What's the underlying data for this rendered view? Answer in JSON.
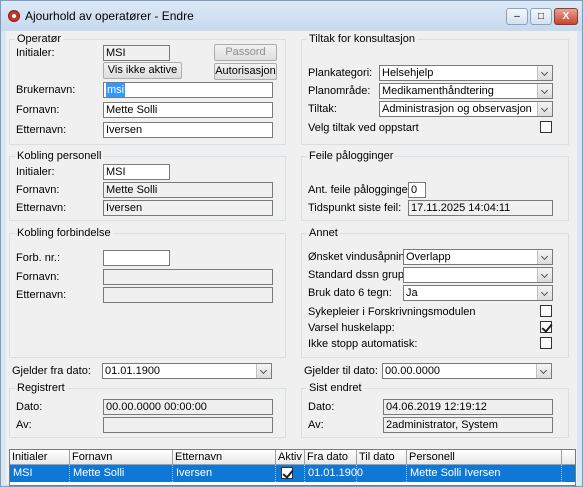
{
  "window": {
    "title": "Ajourhold av operatører - Endre",
    "minimize": "–",
    "maximize": "□",
    "close": "X"
  },
  "operator": {
    "title": "Operatør",
    "initials_label": "Initialer:",
    "initials": "MSI",
    "password_button": "Passord",
    "show_inactive_button": "Vis ikke aktive",
    "authorization_button": "Autorisasjon",
    "username_label": "Brukernavn:",
    "username": "msi",
    "firstname_label": "Fornavn:",
    "firstname": "Mette Solli",
    "lastname_label": "Etternavn:",
    "lastname": "Iversen"
  },
  "measures": {
    "title": "Tiltak for konsultasjon",
    "plan_category_label": "Plankategori:",
    "plan_category": "Helsehjelp",
    "plan_area_label": "Planområde:",
    "plan_area": "Medikamenthåndtering",
    "measure_label": "Tiltak:",
    "measure": "Administrasjon og observasjon",
    "startup_label": "Velg tiltak ved oppstart",
    "startup_checked": false
  },
  "person_link": {
    "title": "Kobling personell",
    "initials_label": "Initialer:",
    "initials": "MSI",
    "firstname_label": "Fornavn:",
    "firstname": "Mette Solli",
    "lastname_label": "Etternavn:",
    "lastname": "Iversen"
  },
  "failed_logins": {
    "title": "Feile pålogginger",
    "count_label": "Ant. feile pålogginger:",
    "count": "0",
    "last_time_label": "Tidspunkt siste feil:",
    "last_time": "17.11.2025 14:04:11"
  },
  "connection_link": {
    "title": "Kobling forbindelse",
    "forb_label": "Forb. nr.:",
    "forb": "",
    "firstname_label": "Fornavn:",
    "firstname": "",
    "lastname_label": "Etternavn:",
    "lastname": ""
  },
  "other": {
    "title": "Annet",
    "window_opening_label": "Ønsket vindusåpning:",
    "window_opening": "Overlapp",
    "standard_group_label": "Standard dssn gruppe:",
    "standard_group": "",
    "date6_label": "Bruk dato 6 tegn:",
    "date6": "Ja",
    "nurse_label": "Sykepleier i Forskrivningsmodulen",
    "nurse_checked": false,
    "reminder_label": "Varsel huskelapp:",
    "reminder_checked": true,
    "autostop_label": "Ikke stopp automatisk:",
    "autostop_checked": false
  },
  "validity": {
    "from_label": "Gjelder fra dato:",
    "from": "01.01.1900",
    "to_label": "Gjelder til dato:",
    "to": "00.00.0000"
  },
  "registered": {
    "title": "Registrert",
    "date_label": "Dato:",
    "date": "00.00.0000 00:00:00",
    "by_label": "Av:",
    "by": ""
  },
  "last_changed": {
    "title": "Sist endret",
    "date_label": "Dato:",
    "date": "04.06.2019 12:19:12",
    "by_label": "Av:",
    "by": "2administrator, System"
  },
  "table": {
    "columns": [
      "Initialer",
      "Fornavn",
      "Etternavn",
      "Aktiv",
      "Fra dato",
      "Til dato",
      "Personell"
    ],
    "rows": [
      {
        "initialer": "MSI",
        "fornavn": "Mette Solli",
        "etternavn": "Iversen",
        "aktiv": true,
        "fra": "01.01.1900",
        "til": "",
        "personell": "Mette Solli Iversen"
      }
    ]
  }
}
